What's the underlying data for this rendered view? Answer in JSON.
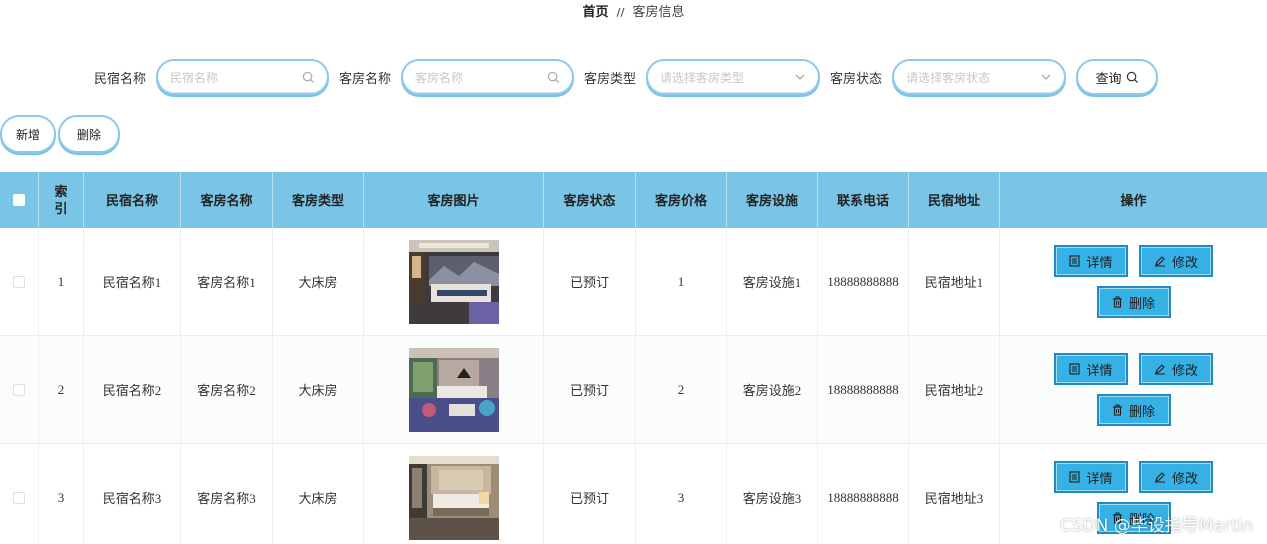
{
  "breadcrumb": {
    "home": "首页",
    "separator": "//",
    "current": "客房信息"
  },
  "search": {
    "homestay_label": "民宿名称",
    "homestay_placeholder": "民宿名称",
    "room_label": "客房名称",
    "room_placeholder": "客房名称",
    "type_label": "客房类型",
    "type_placeholder": "请选择客房类型",
    "status_label": "客房状态",
    "status_placeholder": "请选择客房状态",
    "query_label": "查询"
  },
  "actions": {
    "add_label": "新增",
    "delete_label": "删除"
  },
  "table": {
    "headers": [
      "",
      "索引",
      "民宿名称",
      "客房名称",
      "客房类型",
      "客房图片",
      "客房状态",
      "客房价格",
      "客房设施",
      "联系电话",
      "民宿地址",
      "操作"
    ],
    "rows": [
      {
        "index": "1",
        "homestay": "民宿名称1",
        "room": "客房名称1",
        "type": "大床房",
        "status": "已预订",
        "price": "1",
        "facility": "客房设施1",
        "phone": "18888888888",
        "address": "民宿地址1"
      },
      {
        "index": "2",
        "homestay": "民宿名称2",
        "room": "客房名称2",
        "type": "大床房",
        "status": "已预订",
        "price": "2",
        "facility": "客房设施2",
        "phone": "18888888888",
        "address": "民宿地址2"
      },
      {
        "index": "3",
        "homestay": "民宿名称3",
        "room": "客房名称3",
        "type": "大床房",
        "status": "已预订",
        "price": "3",
        "facility": "客房设施3",
        "phone": "18888888888",
        "address": "民宿地址3"
      }
    ],
    "ops": {
      "detail": "详情",
      "edit": "修改",
      "delete": "删除"
    }
  },
  "watermark": "CSDN @毕设指导Martin",
  "colors": {
    "header_bg": "#7ac5e6",
    "button_bg": "#35b1e5",
    "input_border": "#8fc8ea"
  }
}
